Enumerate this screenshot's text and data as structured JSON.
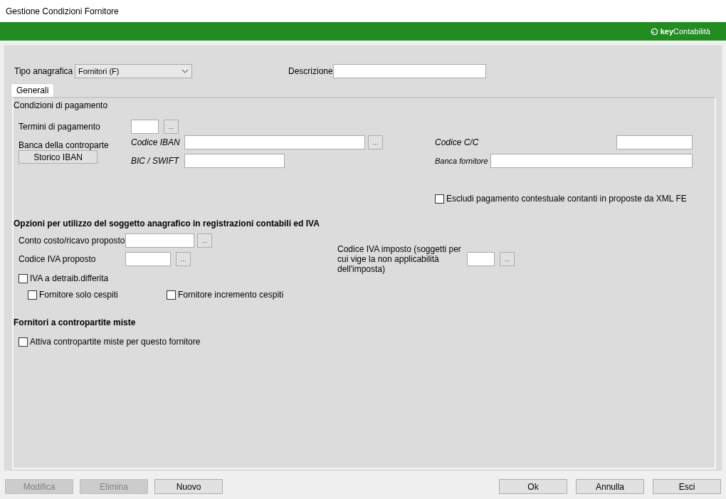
{
  "window": {
    "title": "Gestione Condizioni Fornitore"
  },
  "brand": {
    "strong": "key",
    "rest": "Contabilità"
  },
  "header": {
    "type_label": "Tipo anagrafica",
    "type_value": "Fornitori (F)",
    "description_label": "Descrizione"
  },
  "tabs": [
    {
      "label": "Generali",
      "selected": true
    }
  ],
  "payment": {
    "heading": "Condizioni di pagamento",
    "terms": {
      "label": "Termini di pagamento",
      "button": "..."
    },
    "bank_label": "Banca della controparte",
    "history_button": "Storico IBAN",
    "iban": {
      "label": "Codice IBAN",
      "button": "..."
    },
    "bic": {
      "label": "BIC / SWIFT"
    },
    "account": {
      "label": "Codice C/C"
    },
    "supplier_bank": {
      "label": "Banca fornitore"
    },
    "exclude_cash": {
      "label": "Escludi pagamento contestuale contanti in proposte da XML FE",
      "checked": false
    }
  },
  "options": {
    "heading": "Opzioni per utilizzo del soggetto anagrafico in registrazioni contabili ed IVA",
    "cost_account": {
      "label": "Conto costo/ricavo proposto",
      "button": "..."
    },
    "vat_code": {
      "label": "Codice IVA proposto",
      "button": "..."
    },
    "imposed_vat": {
      "label": "Codice IVA imposto (soggetti per cui vige la non applicabilità dell'imposta)",
      "button": "..."
    },
    "deferred_vat": {
      "label": "IVA a detraib.differita",
      "checked": false
    },
    "assets_only": {
      "label": "Fornitore solo cespiti",
      "checked": false
    },
    "assets_increment": {
      "label": "Fornitore incremento cespiti",
      "checked": false
    }
  },
  "mixed": {
    "heading": "Fornitori a contropartite miste",
    "activate": {
      "label": "Attiva contropartite miste per questo fornitore",
      "checked": false
    }
  },
  "buttons_left": [
    {
      "label": "Modifica",
      "disabled": true
    },
    {
      "label": "Elimina",
      "disabled": true
    },
    {
      "label": "Nuovo",
      "disabled": false
    }
  ],
  "buttons_right": [
    {
      "label": "Ok",
      "disabled": false
    },
    {
      "label": "Annulla",
      "disabled": false
    },
    {
      "label": "Esci",
      "disabled": false
    }
  ]
}
